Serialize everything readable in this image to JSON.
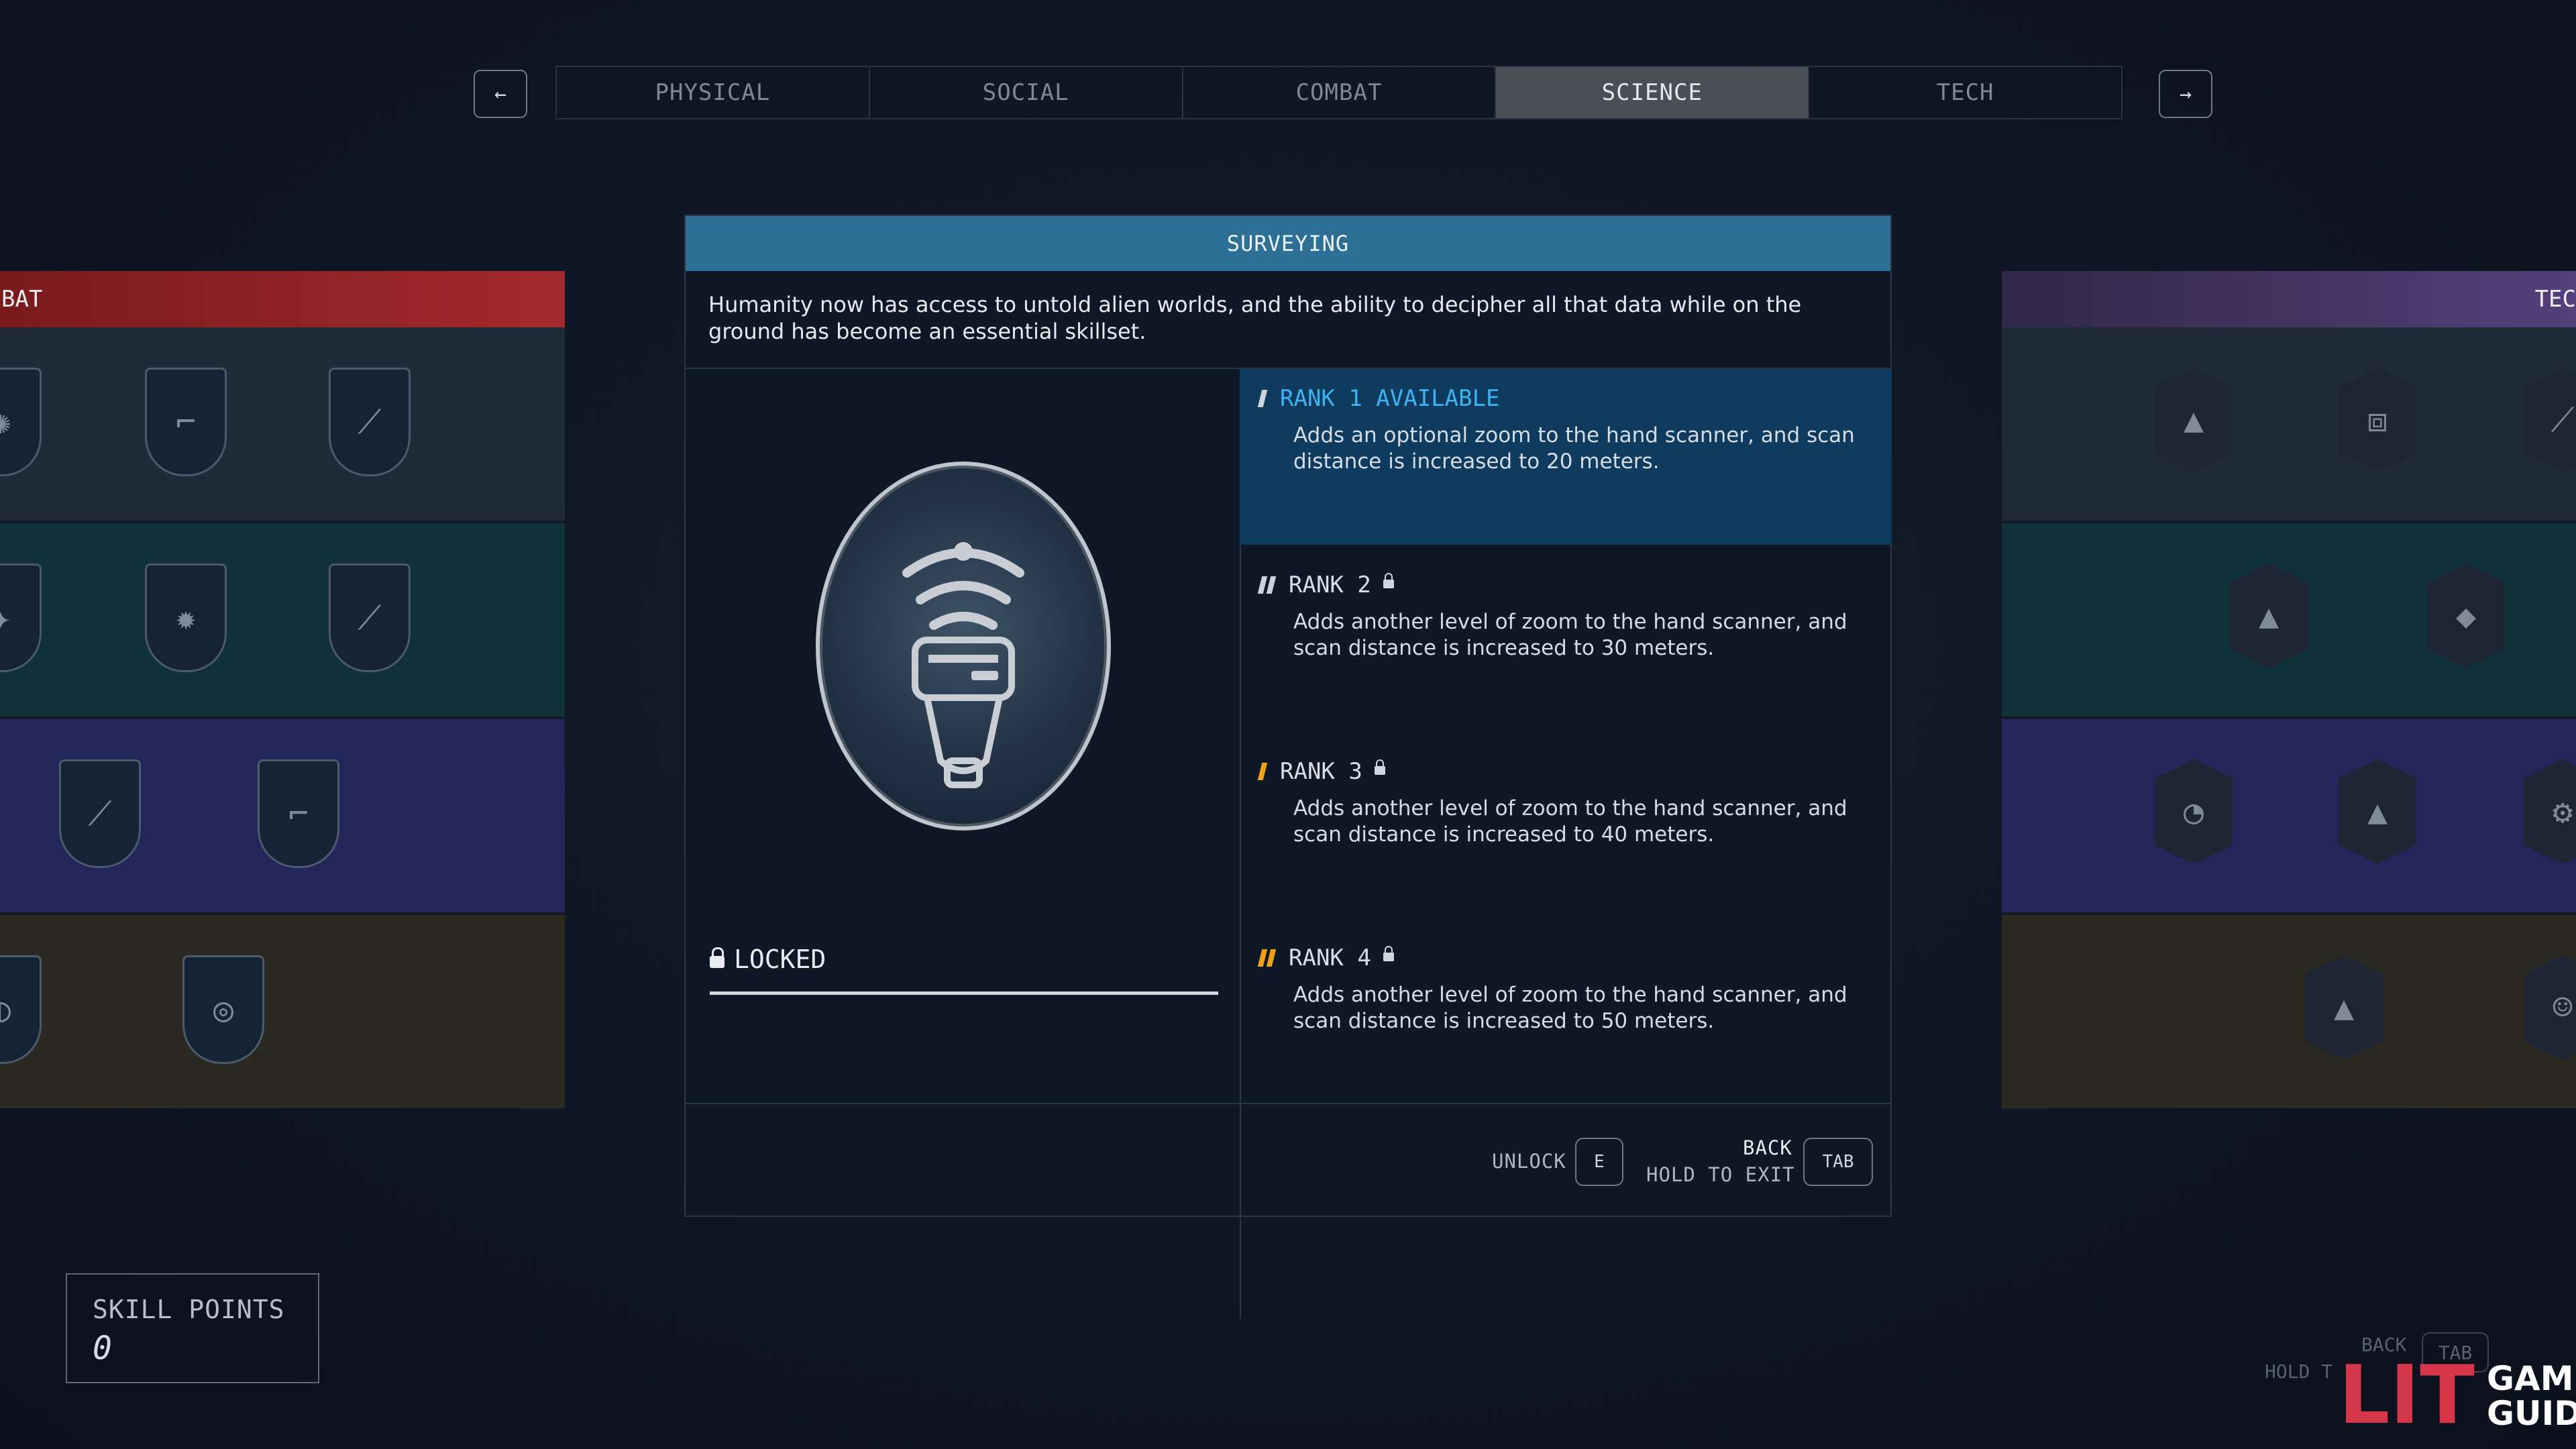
{
  "nav": {
    "prev_icon": "arrow-left-icon",
    "next_icon": "arrow-right-icon",
    "prev_glyph": "←",
    "next_glyph": "→",
    "tabs": [
      {
        "label": "PHYSICAL",
        "active": false
      },
      {
        "label": "SOCIAL",
        "active": false
      },
      {
        "label": "COMBAT",
        "active": false
      },
      {
        "label": "SCIENCE",
        "active": true
      },
      {
        "label": "TECH",
        "active": false
      }
    ]
  },
  "left_panel": {
    "header": "BAT",
    "header_color": "#8f1f22"
  },
  "right_panel": {
    "header": "TEC",
    "header_color": "#4b3a6a"
  },
  "skill": {
    "title": "SURVEYING",
    "description": "Humanity now has access to untold alien worlds, and the ability to decipher all that data while on the ground has become an essential skillset.",
    "icon": "hand-scanner-icon",
    "status": "LOCKED",
    "ranks": [
      {
        "label": "RANK 1 AVAILABLE",
        "text": "Adds an optional zoom to the hand scanner, and scan distance is increased to 20 meters.",
        "locked": false
      },
      {
        "label": "RANK 2",
        "text": "Adds another level of zoom to the hand scanner, and scan distance is increased to 30 meters.",
        "locked": true
      },
      {
        "label": "RANK 3",
        "text": "Adds another level of zoom to the hand scanner, and scan distance is increased to 40 meters.",
        "locked": true
      },
      {
        "label": "RANK 4",
        "text": "Adds another level of zoom to the hand scanner, and scan distance is increased to 50 meters.",
        "locked": true
      }
    ]
  },
  "footer": {
    "unlock_label": "UNLOCK",
    "unlock_key": "E",
    "back_label": "BACK",
    "exit_label": "HOLD TO EXIT",
    "tab_key": "TAB"
  },
  "skill_points": {
    "label": "SKILL POINTS",
    "value": "0"
  },
  "ghost_footer": {
    "back": "BACK",
    "hold": "HOLD T",
    "key": "TAB"
  },
  "watermark": {
    "mark": "LIT",
    "line1": "GAMER",
    "line2": "GUIDES"
  },
  "colors": {
    "accent": "#2e6f95",
    "rank_active": "#3fb3f2",
    "pip_gold": "#f0a019"
  }
}
